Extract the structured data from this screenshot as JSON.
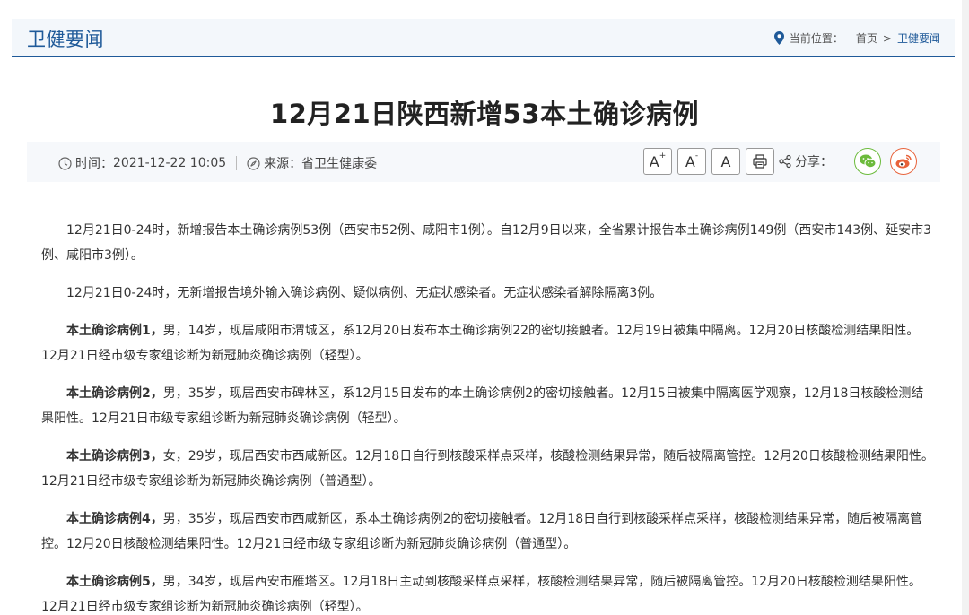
{
  "header": {
    "section_title": "卫健要闻",
    "location_label": "当前位置：",
    "breadcrumb": {
      "home": "首页",
      "separator": ">",
      "current": "卫健要闻"
    }
  },
  "article": {
    "title": "12月21日陕西新增53本土确诊病例",
    "meta": {
      "time_label": "时间：",
      "time_value": "2021-12-22 10:05",
      "source_label": "来源：",
      "source_value": "省卫生健康委",
      "font_large": "A",
      "font_small": "A",
      "font_normal": "A",
      "share_label": "分享："
    },
    "paragraphs": [
      {
        "bold": "",
        "text": "12月21日0-24时，新增报告本土确诊病例53例（西安市52例、咸阳市1例）。自12月9日以来，全省累计报告本土确诊病例149例（西安市143例、延安市3例、咸阳市3例）。"
      },
      {
        "bold": "",
        "text": "12月21日0-24时，无新增报告境外输入确诊病例、疑似病例、无症状感染者。无症状感染者解除隔离3例。"
      },
      {
        "bold": "本土确诊病例1，",
        "text": "男，14岁，现居咸阳市渭城区，系12月20日发布本土确诊病例22的密切接触者。12月19日被集中隔离。12月20日核酸检测结果阳性。12月21日经市级专家组诊断为新冠肺炎确诊病例（轻型）。"
      },
      {
        "bold": "本土确诊病例2，",
        "text": "男，35岁，现居西安市碑林区，系12月15日发布的本土确诊病例2的密切接触者。12月15日被集中隔离医学观察，12月18日核酸检测结果阳性。12月21日市级专家组诊断为新冠肺炎确诊病例（轻型）。"
      },
      {
        "bold": "本土确诊病例3，",
        "text": "女，29岁，现居西安市西咸新区。12月18日自行到核酸采样点采样，核酸检测结果异常，随后被隔离管控。12月20日核酸检测结果阳性。12月21日经市级专家组诊断为新冠肺炎确诊病例（普通型）。"
      },
      {
        "bold": "本土确诊病例4，",
        "text": "男，35岁，现居西安市西咸新区，系本土确诊病例2的密切接触者。12月18日自行到核酸采样点采样，核酸检测结果异常，随后被隔离管控。12月20日核酸检测结果阳性。12月21日经市级专家组诊断为新冠肺炎确诊病例（普通型）。"
      },
      {
        "bold": "本土确诊病例5，",
        "text": "男，34岁，现居西安市雁塔区。12月18日主动到核酸采样点采样，核酸检测结果异常，随后被隔离管控。12月20日核酸检测结果阳性。12月21日经市级专家组诊断为新冠肺炎确诊病例（轻型）。"
      }
    ]
  },
  "icons": {
    "location": "map-pin-icon",
    "time": "clock-icon",
    "source": "compass-icon",
    "print": "printer-icon",
    "share": "share-icon",
    "wechat": "wechat-icon",
    "weibo": "weibo-icon"
  },
  "colors": {
    "accent": "#1f5a99",
    "wechat": "#6cbb3c",
    "weibo": "#e8623a"
  }
}
